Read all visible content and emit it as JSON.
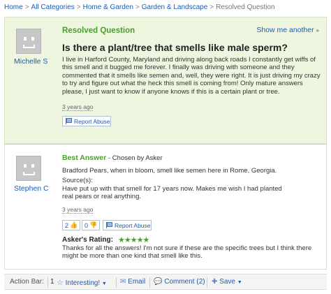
{
  "breadcrumb": {
    "items": [
      "Home",
      "All Categories",
      "Home & Garden",
      "Garden & Landscape"
    ],
    "current": "Resolved Question",
    "separator": ">"
  },
  "question": {
    "status_label": "Resolved Question",
    "show_more": "Show me another",
    "asker": "Michelle S",
    "title": "Is there a plant/tree that smells like male sperm?",
    "body": "I live in Harford County, Maryland and driving along back roads I constantly get wiffs of this smell and it bugged me forever. I finally was driving with someone and they commented that it smells like semen and, well, they were right. It is just driving my crazy to try and figure out what the heck this smell is coming from! Only mature answers please, I just want to know if anyone knows if this is a certain plant or tree.",
    "timestamp": "3 years ago",
    "report_label": "Report Abuse"
  },
  "answer": {
    "heading": "Best Answer",
    "chosen_by": "- Chosen by Asker",
    "answerer": "Stephen C",
    "body": "Bradford Pears, when in bloom, smell like semen here in Rome, Georgia.",
    "sources_label": "Source(s):",
    "sources_text": "Have put up with that smell for 17 years now. Makes me wish I had planted real pears or real anything.",
    "timestamp": "3 years ago",
    "thumbs_up": "2",
    "thumbs_down": "0",
    "report_label": "Report Abuse",
    "rating_label": "Asker's Rating:",
    "rating": 5,
    "rating_stars": "★★★★★",
    "rating_comment": "Thanks for all the answers! I'm not sure if these are the specific trees but I think there might be more than one kind that smell like this."
  },
  "action_bar": {
    "label": "Action Bar:",
    "interesting_count": "1",
    "interesting_label": "Interesting!",
    "email_label": "Email",
    "comment_label": "Comment (2)",
    "save_label": "Save"
  },
  "colors": {
    "accent_green": "#4aa02c",
    "link_blue": "#1a5bb5",
    "question_bg": "#eef6e0"
  }
}
